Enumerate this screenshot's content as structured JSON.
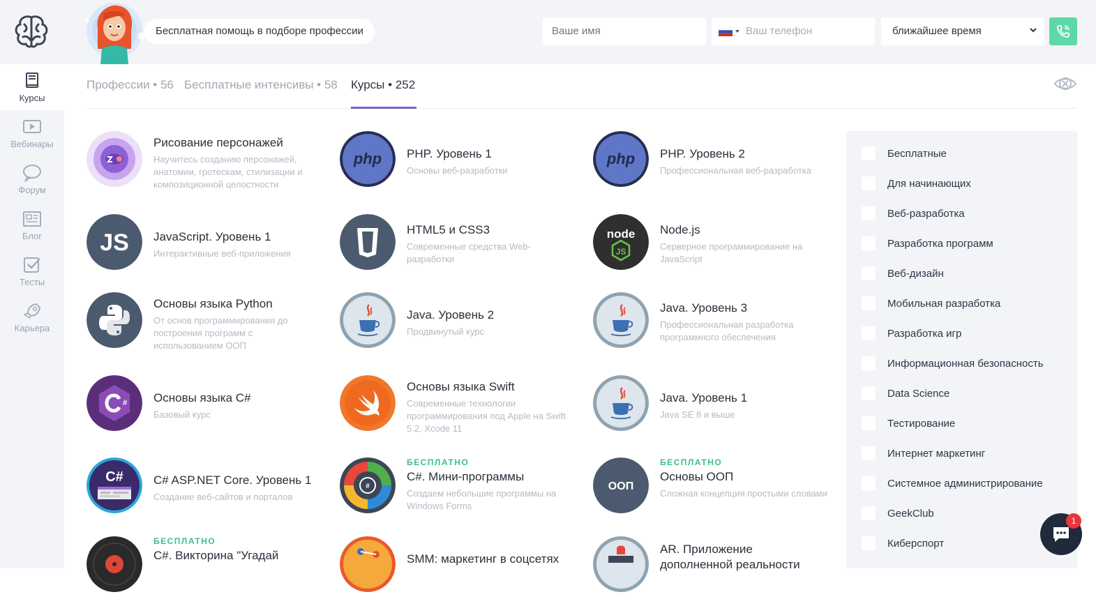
{
  "header": {
    "help_text": "Бесплатная помощь в подборе профессии",
    "name_placeholder": "Ваше имя",
    "phone_placeholder": "Ваш телефон",
    "time_select_value": "ближайшее время",
    "call_icon": "phone-icon"
  },
  "sidebar": {
    "logo_icon": "brain-logo-icon",
    "items": [
      {
        "label": "Курсы",
        "icon": "book-icon",
        "active": true
      },
      {
        "label": "Вебинары",
        "icon": "video-icon",
        "active": false
      },
      {
        "label": "Форум",
        "icon": "chat-bubble-icon",
        "active": false
      },
      {
        "label": "Блог",
        "icon": "blog-icon",
        "active": false
      },
      {
        "label": "Тесты",
        "icon": "checkbox-icon",
        "active": false
      },
      {
        "label": "Карьера",
        "icon": "rocket-icon",
        "active": false
      }
    ]
  },
  "tabs": [
    {
      "label": "Профессии • 56",
      "active": false
    },
    {
      "label": "Бесплатные интенсивы • 58",
      "active": false
    },
    {
      "label": "Курсы • 252",
      "active": true
    }
  ],
  "courses": [
    {
      "title": "Рисование персонажей",
      "desc": "Научитесь созданию персонажей, анатомии, гротескам, стилизации и композиционной целостности",
      "badge": "",
      "icon": "character-drawing-icon"
    },
    {
      "title": "PHP. Уровень 1",
      "desc": "Основы веб-разработки",
      "badge": "",
      "icon": "php-icon"
    },
    {
      "title": "PHP. Уровень 2",
      "desc": "Профессиональная веб-разработка",
      "badge": "",
      "icon": "php-icon"
    },
    {
      "title": "JavaScript. Уровень 1",
      "desc": "Интерактивные веб-приложения",
      "badge": "",
      "icon": "js-icon"
    },
    {
      "title": "HTML5 и CSS3",
      "desc": "Современные средства Web-разработки",
      "badge": "",
      "icon": "html5-icon"
    },
    {
      "title": "Node.js",
      "desc": "Серверное программирование на JavaScript",
      "badge": "",
      "icon": "nodejs-icon"
    },
    {
      "title": "Основы языка Python",
      "desc": "От основ программирования до построения программ с использованием ООП",
      "badge": "",
      "icon": "python-icon"
    },
    {
      "title": "Java. Уровень 2",
      "desc": "Продвинутый курс",
      "badge": "",
      "icon": "java-icon"
    },
    {
      "title": "Java. Уровень 3",
      "desc": "Профессиональная разработка программного обеспечения",
      "badge": "",
      "icon": "java-icon"
    },
    {
      "title": "Основы языка C#",
      "desc": "Базовый курс",
      "badge": "",
      "icon": "csharp-icon"
    },
    {
      "title": "Основы языка Swift",
      "desc": "Современные технологии программирования под Apple на Swift 5.2, Xcode 11",
      "badge": "",
      "icon": "swift-icon"
    },
    {
      "title": "Java. Уровень 1",
      "desc": "Java SE 8 и выше",
      "badge": "",
      "icon": "java-icon"
    },
    {
      "title": "C# ASP.NET Core. Уровень 1",
      "desc": "Создание веб-сайтов и порталов",
      "badge": "",
      "icon": "csharp-aspnet-icon"
    },
    {
      "title": "C#. Мини-программы",
      "desc": "Создаем небольшие программы на Windows Forms",
      "badge": "БЕСПЛАТНО",
      "icon": "csharp-mini-icon"
    },
    {
      "title": "Основы ООП",
      "desc": "Сложная концепция простыми словами",
      "badge": "БЕСПЛАТНО",
      "icon": "oop-icon"
    },
    {
      "title": "C#. Викторина \"Угадай",
      "desc": "",
      "badge": "БЕСПЛАТНО",
      "icon": "vinyl-record-icon"
    },
    {
      "title": "SMM: маркетинг в соцсетях",
      "desc": "",
      "badge": "",
      "icon": "smm-icon"
    },
    {
      "title": "AR. Приложение дополненной реальности",
      "desc": "",
      "badge": "",
      "icon": "ar-icon"
    }
  ],
  "oop_icon_text": "ООП",
  "filters": [
    "Бесплатные",
    "Для начинающих",
    "Веб-разработка",
    "Разработка программ",
    "Веб-дизайн",
    "Мобильная разработка",
    "Разработка игр",
    "Информационная безопасность",
    "Data Science",
    "Тестирование",
    "Интернет маркетинг",
    "Системное администрирование",
    "GeekClub",
    "Киберспорт"
  ],
  "chat": {
    "count": "1",
    "icon": "chat-icon"
  },
  "colors": {
    "accent": "#7a64c8",
    "free_badge": "#3fbf8a",
    "call_button": "#5cd9a6",
    "chat_button": "#1f2a3c",
    "notification": "#e8363c"
  }
}
